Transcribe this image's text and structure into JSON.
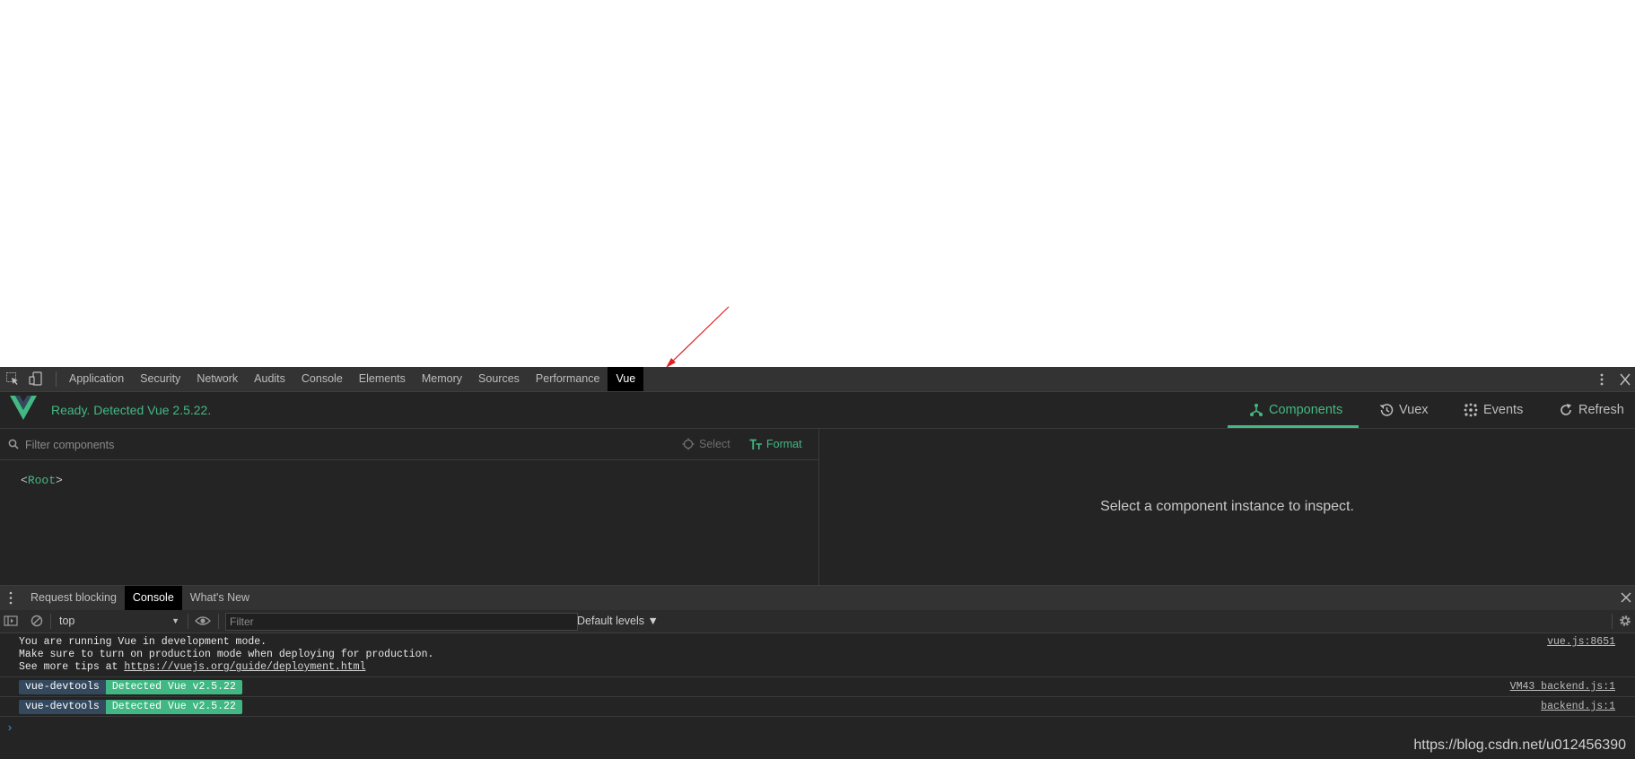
{
  "devtools": {
    "tabs": [
      {
        "label": "Application",
        "active": false
      },
      {
        "label": "Security",
        "active": false
      },
      {
        "label": "Network",
        "active": false
      },
      {
        "label": "Audits",
        "active": false
      },
      {
        "label": "Console",
        "active": false
      },
      {
        "label": "Elements",
        "active": false
      },
      {
        "label": "Memory",
        "active": false
      },
      {
        "label": "Sources",
        "active": false
      },
      {
        "label": "Performance",
        "active": false
      },
      {
        "label": "Vue",
        "active": true
      }
    ],
    "icons": {
      "inspect": "inspect-element-icon",
      "device": "device-toolbar-icon",
      "more": "kebab-menu-icon",
      "close": "close-icon"
    }
  },
  "vue": {
    "status": "Ready. Detected Vue 2.5.22.",
    "nav": {
      "components": "Components",
      "vuex": "Vuex",
      "events": "Events",
      "refresh": "Refresh"
    },
    "filter_placeholder": "Filter components",
    "select_label": "Select",
    "format_label": "Format",
    "root_open": "<",
    "root_name": "Root",
    "root_close": ">",
    "inspect_message": "Select a component instance to inspect.",
    "colors": {
      "accent": "#42b983",
      "navy": "#35495e"
    }
  },
  "drawer": {
    "tabs": [
      {
        "label": "Request blocking",
        "active": false
      },
      {
        "label": "Console",
        "active": true
      },
      {
        "label": "What's New",
        "active": false
      }
    ]
  },
  "console": {
    "context": "top",
    "filter_placeholder": "Filter",
    "levels": "Default levels ▼",
    "messages": {
      "line1": "You are running Vue in development mode.",
      "line2": "Make sure to turn on production mode when deploying for production.",
      "line3_prefix": "See more tips at ",
      "line3_link": "https://vuejs.org/guide/deployment.html",
      "source1": "vue.js:8651",
      "badge_a": "vue-devtools",
      "badge_b": "Detected Vue v2.5.22",
      "source2": "VM43 backend.js:1",
      "source3": "backend.js:1"
    },
    "prompt": "›"
  },
  "watermark": "https://blog.csdn.net/u012456390"
}
